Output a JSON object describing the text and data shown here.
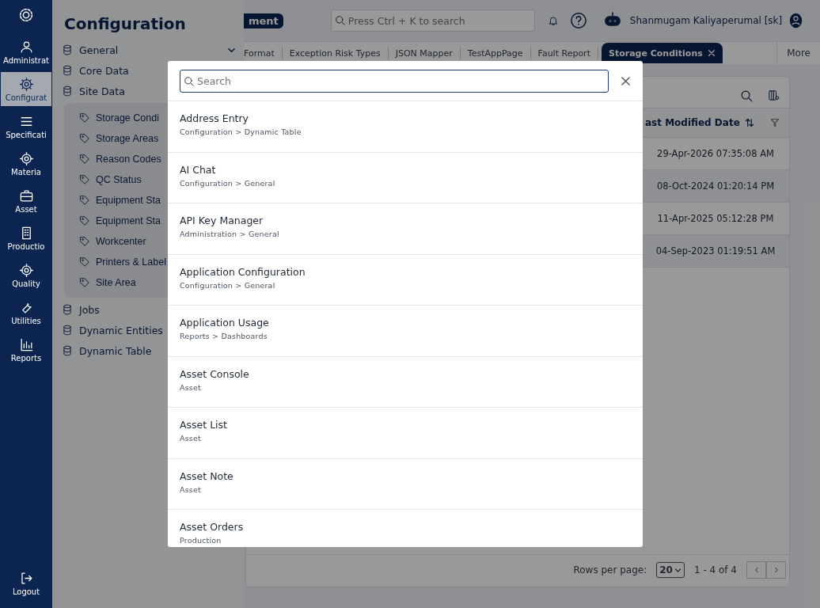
{
  "rail": {
    "items": [
      {
        "label": "Administrat",
        "selected": false
      },
      {
        "label": "Configurat",
        "selected": true
      },
      {
        "label": "Specificati",
        "selected": false
      },
      {
        "label": "Materia",
        "selected": false
      },
      {
        "label": "Asset",
        "selected": false
      },
      {
        "label": "Productio",
        "selected": false
      },
      {
        "label": "Quality",
        "selected": false
      },
      {
        "label": "Utilities",
        "selected": false
      },
      {
        "label": "Reports",
        "selected": false
      }
    ],
    "logout": "Logout"
  },
  "config_panel": {
    "title": "Configuration",
    "items": [
      {
        "label": "General",
        "chevron": true
      },
      {
        "label": "Core Data"
      },
      {
        "label": "Site Data",
        "children": [
          {
            "label": "Storage Condi"
          },
          {
            "label": "Storage Areas"
          },
          {
            "label": "Reason Codes"
          },
          {
            "label": "QC Status"
          },
          {
            "label": "Equipment Sta"
          },
          {
            "label": "Equipment Sta"
          },
          {
            "label": "Workcenter"
          },
          {
            "label": "Printers & Label"
          },
          {
            "label": "Site Area"
          }
        ]
      },
      {
        "label": "Jobs"
      },
      {
        "label": "Dynamic Entities"
      },
      {
        "label": "Dynamic Table"
      }
    ]
  },
  "header": {
    "badge": "ment",
    "search": {
      "placeholder": "Press Ctrl + K to search"
    },
    "user": "Shanmugam Kaliyaperumal [sk]"
  },
  "tabs": [
    {
      "label": "Format",
      "selected": false,
      "closable": false
    },
    {
      "label": "Exception Risk Types",
      "selected": false,
      "closable": false
    },
    {
      "label": "JSON Mapper",
      "selected": false,
      "closable": false
    },
    {
      "label": "TestAppPage",
      "selected": false,
      "closable": false
    },
    {
      "label": "Fault Report",
      "selected": false,
      "closable": false
    },
    {
      "label": "Storage Conditions",
      "selected": true,
      "closable": true
    }
  ],
  "more": "More",
  "table": {
    "column": "ast Modified Date",
    "rows": [
      "29-Apr-2026 07:35:08 AM",
      "08-Oct-2024 01:20:14 PM",
      "11-Apr-2025 05:12:28 PM",
      "04-Sep-2023 01:19:51 AM"
    ]
  },
  "pager": {
    "label": "Rows per page:",
    "value": "20",
    "range": "1 - 4 of 4"
  },
  "dialog": {
    "search": {
      "placeholder": "Search"
    },
    "results": [
      {
        "title": "Address Entry",
        "path": "Configuration > Dynamic Table"
      },
      {
        "title": "AI Chat",
        "path": "Configuration > General"
      },
      {
        "title": "API Key Manager",
        "path": "Administration > General"
      },
      {
        "title": "Application Configuration",
        "path": "Configuration > General"
      },
      {
        "title": "Application Usage",
        "path": "Reports > Dashboards"
      },
      {
        "title": "Asset Console",
        "path": "Asset"
      },
      {
        "title": "Asset List",
        "path": "Asset"
      },
      {
        "title": "Asset Note",
        "path": "Asset"
      },
      {
        "title": "Asset Orders",
        "path": "Production"
      }
    ]
  }
}
